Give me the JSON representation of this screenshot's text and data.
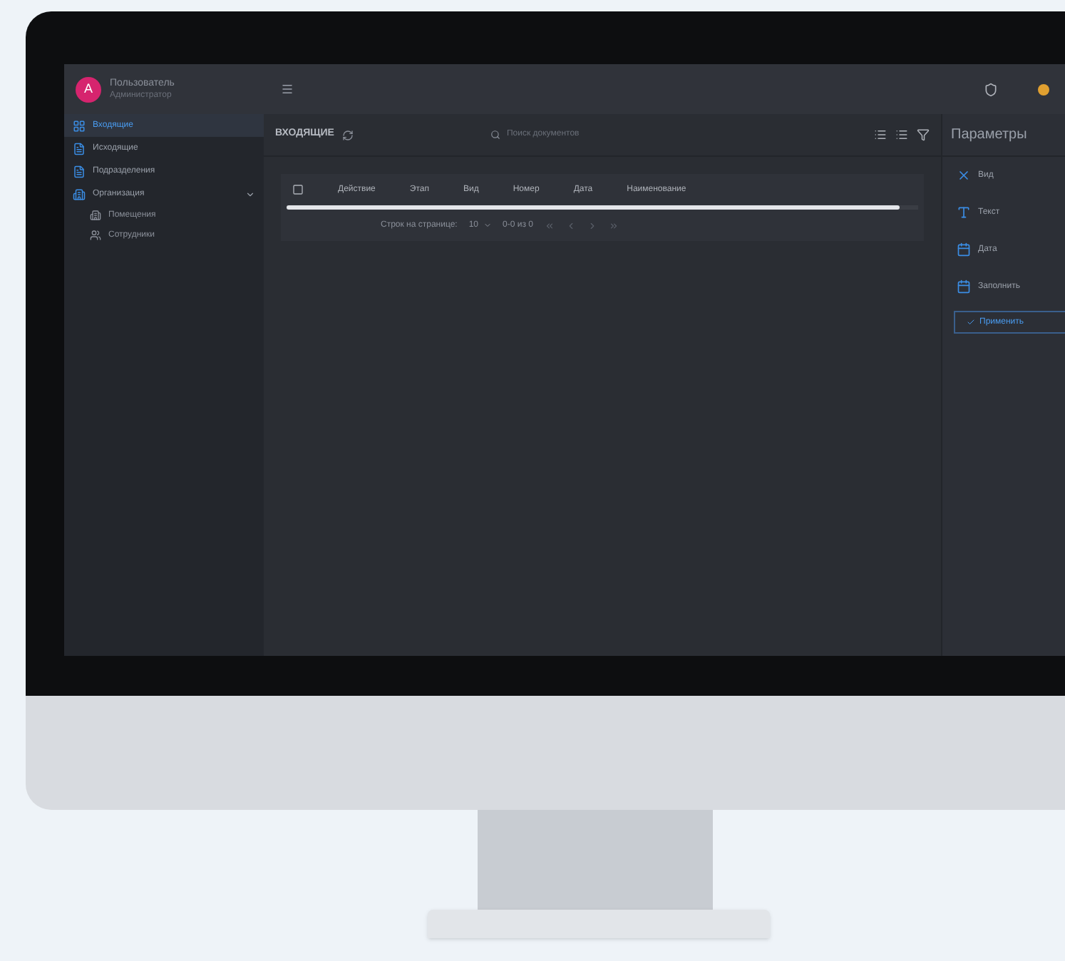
{
  "user": {
    "initial": "А",
    "name": "Пользователь",
    "role": "Администратор"
  },
  "sidebar": {
    "items": [
      {
        "label": "Входящие",
        "selected": true
      },
      {
        "label": "Исходящие",
        "selected": false
      },
      {
        "label": "Подразделения",
        "selected": false
      },
      {
        "label": "Организация",
        "selected": false,
        "expanded": true,
        "children": [
          {
            "label": "Помещения",
            "selected": false
          },
          {
            "label": "Сотрудники",
            "selected": false
          }
        ]
      }
    ]
  },
  "content": {
    "title": "ВХОДЯЩИЕ",
    "search": {
      "placeholder": "Поиск документов"
    },
    "table": {
      "select_all": {
        "checked": false
      },
      "columns": [
        "Действие",
        "Этап",
        "Вид",
        "Номер",
        "Дата",
        "Наименование"
      ],
      "progress": {
        "level": 0.97
      }
    },
    "pagination": {
      "rows_label": "Строк на странице:",
      "rows_value": "10",
      "range": "0-0 из 0"
    }
  },
  "params": {
    "title": "Параметры",
    "fields": [
      {
        "label": "Вид"
      },
      {
        "label": "Текст"
      },
      {
        "label": "Дата"
      },
      {
        "label": "Заполнить"
      }
    ],
    "button": "Применить"
  }
}
